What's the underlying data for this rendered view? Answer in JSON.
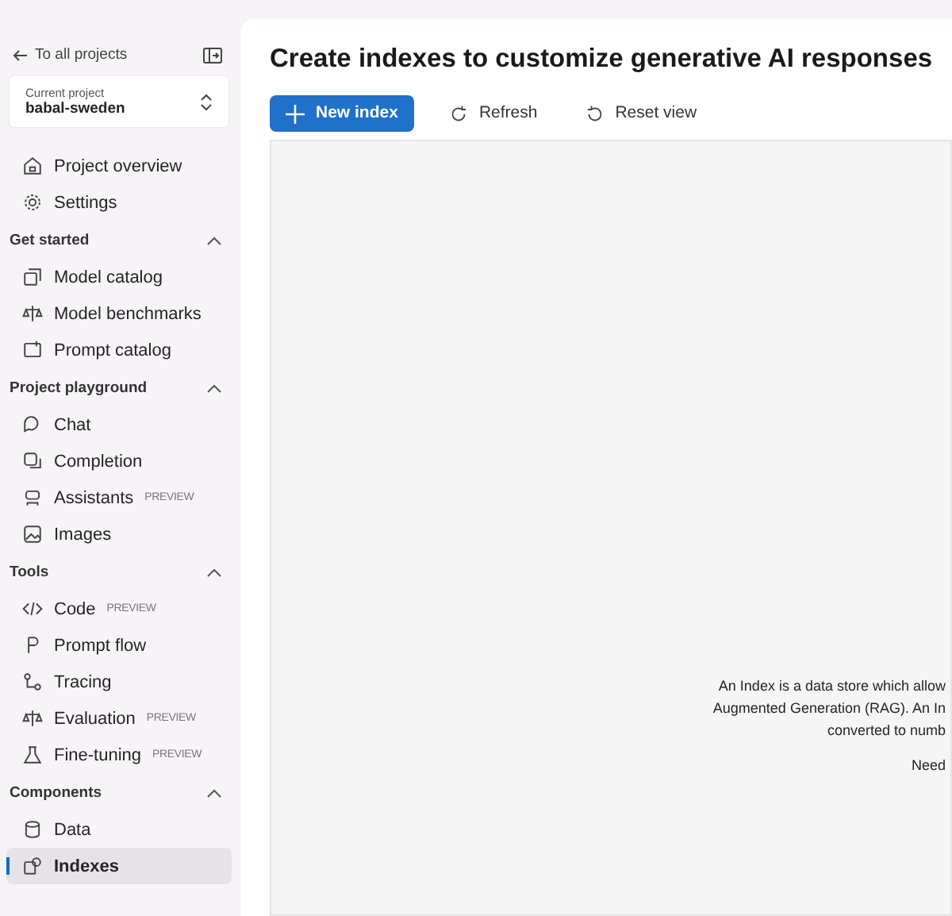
{
  "sidebar": {
    "back_link": "To all projects",
    "project_picker": {
      "label": "Current project",
      "value": "babal-sweden"
    },
    "top_items": [
      {
        "label": "Project overview",
        "selected": false
      },
      {
        "label": "Settings",
        "selected": false
      }
    ],
    "sections": [
      {
        "title": "Get started",
        "expanded": true,
        "items": [
          {
            "label": "Model catalog",
            "selected": false
          },
          {
            "label": "Model benchmarks",
            "selected": false
          },
          {
            "label": "Prompt catalog",
            "selected": false
          }
        ]
      },
      {
        "title": "Project playground",
        "expanded": true,
        "items": [
          {
            "label": "Chat",
            "selected": false
          },
          {
            "label": "Completion",
            "selected": false
          },
          {
            "label": "Assistants",
            "badge": "PREVIEW",
            "selected": false
          },
          {
            "label": "Images",
            "selected": false
          }
        ]
      },
      {
        "title": "Tools",
        "expanded": true,
        "items": [
          {
            "label": "Code",
            "badge": "PREVIEW",
            "selected": false
          },
          {
            "label": "Prompt flow",
            "selected": false
          },
          {
            "label": "Tracing",
            "selected": false
          },
          {
            "label": "Evaluation",
            "badge": "PREVIEW",
            "selected": false
          },
          {
            "label": "Fine-tuning",
            "badge": "PREVIEW",
            "selected": false
          }
        ]
      },
      {
        "title": "Components",
        "expanded": true,
        "items": [
          {
            "label": "Data",
            "selected": false
          },
          {
            "label": "Indexes",
            "selected": true
          }
        ]
      }
    ]
  },
  "main": {
    "title": "Create indexes to customize generative AI responses",
    "toolbar": [
      {
        "label": "New index",
        "kind": "primary"
      },
      {
        "label": "Refresh",
        "kind": "refresh"
      },
      {
        "label": "Reset view",
        "kind": "reset"
      }
    ],
    "empty_state": [
      "An Index is a data store which allow",
      "Augmented Generation (RAG). An In",
      "converted to numb",
      "Need"
    ]
  }
}
